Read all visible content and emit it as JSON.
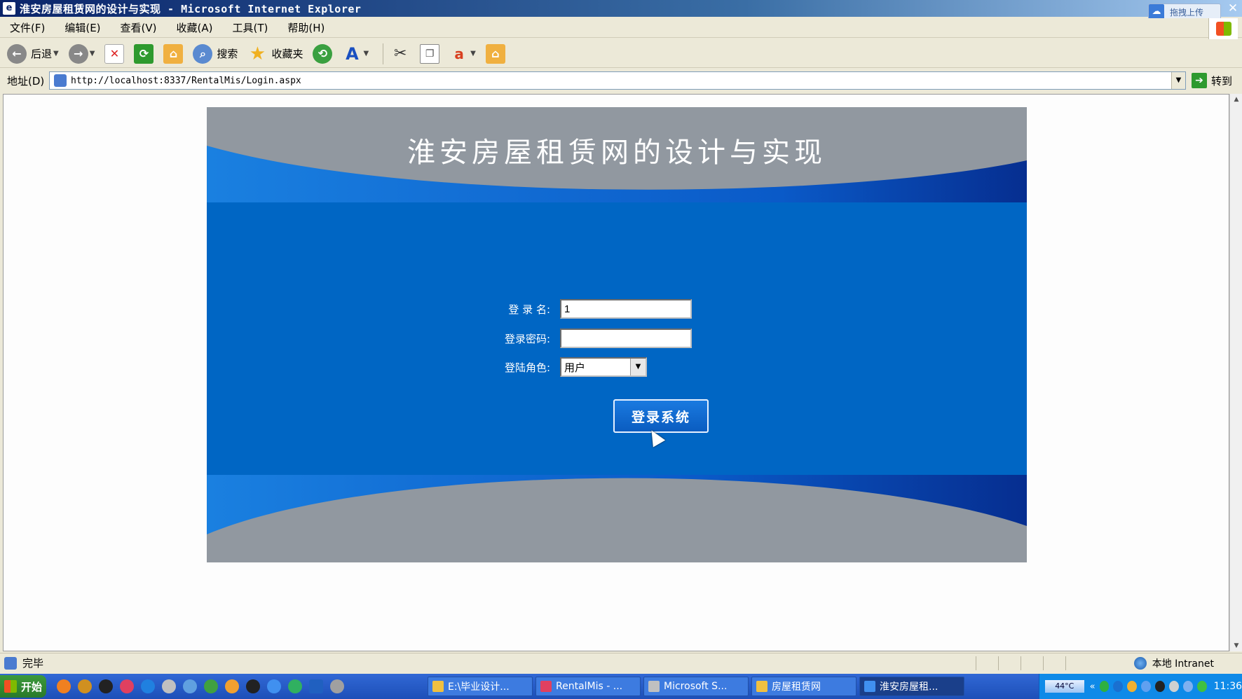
{
  "window": {
    "title": "淮安房屋租赁网的设计与实现 - Microsoft Internet Explorer",
    "upload_widget": "拖拽上传"
  },
  "menu": [
    "文件(F)",
    "编辑(E)",
    "查看(V)",
    "收藏(A)",
    "工具(T)",
    "帮助(H)"
  ],
  "toolbar": {
    "back_label": "后退",
    "search_label": "搜索",
    "favorites_label": "收藏夹"
  },
  "address": {
    "label": "地址(D)",
    "url": "http://localhost:8337/RentalMis/Login.aspx",
    "go_label": "转到"
  },
  "page": {
    "site_title": "淮安房屋租赁网的设计与实现",
    "login_name_label": "登 录 名:",
    "login_name_value": "1",
    "password_label": "登录密码:",
    "password_value": "",
    "role_label": "登陆角色:",
    "role_selected": "用户",
    "submit_label": "登录系统"
  },
  "status": {
    "text": "完毕",
    "zone": "本地 Intranet"
  },
  "taskbar": {
    "start_label": "开始",
    "tasks": [
      {
        "label": "E:\\毕业设计..."
      },
      {
        "label": "RentalMis - ..."
      },
      {
        "label": "Microsoft S..."
      },
      {
        "label": "房屋租赁网"
      },
      {
        "label": "淮安房屋租..."
      }
    ],
    "temperature": "44°C",
    "clock": "11:36"
  },
  "colors": {
    "panel_blue": "#0066c4",
    "panel_gray": "#9198a0",
    "panel_dark_blue": "#0a3aa0"
  }
}
